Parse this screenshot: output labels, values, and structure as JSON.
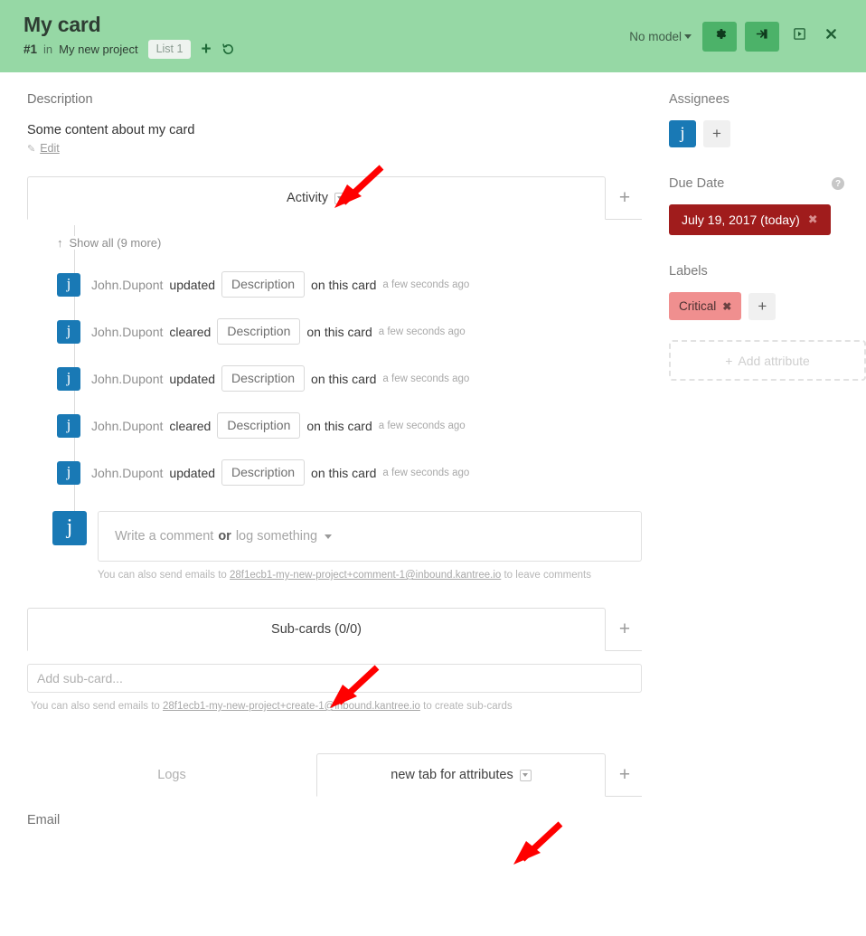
{
  "header": {
    "title": "My card",
    "card_number": "#1",
    "in_word": "in",
    "project": "My new project",
    "list_chip": "List 1",
    "add_icon": "plus-icon",
    "history_icon": "history-icon",
    "model_label": "No model",
    "gear_icon": "gear-icon",
    "login_icon": "sign-in-icon",
    "play_icon": "play-box-icon",
    "close_icon": "close-icon",
    "bg_color": "#96d8a5",
    "button_color": "#4cb269"
  },
  "description": {
    "label": "Description",
    "content": "Some content about my card",
    "edit_label": "Edit",
    "edit_icon": "pencil-icon"
  },
  "activity_tabs": {
    "active": "Activity",
    "caret_icon": "caret-down-box-icon",
    "add_icon": "plus-icon"
  },
  "activity": {
    "show_all": "Show all (9 more)",
    "show_all_icon": "arrow-up-icon",
    "entries": [
      {
        "avatar": "j",
        "user": "John.Dupont",
        "verb": "updated",
        "attribute": "Description",
        "object": "on this card",
        "time": "a few seconds ago"
      },
      {
        "avatar": "j",
        "user": "John.Dupont",
        "verb": "cleared",
        "attribute": "Description",
        "object": "on this card",
        "time": "a few seconds ago"
      },
      {
        "avatar": "j",
        "user": "John.Dupont",
        "verb": "updated",
        "attribute": "Description",
        "object": "on this card",
        "time": "a few seconds ago"
      },
      {
        "avatar": "j",
        "user": "John.Dupont",
        "verb": "cleared",
        "attribute": "Description",
        "object": "on this card",
        "time": "a few seconds ago"
      },
      {
        "avatar": "j",
        "user": "John.Dupont",
        "verb": "updated",
        "attribute": "Description",
        "object": "on this card",
        "time": "a few seconds ago"
      }
    ],
    "comment": {
      "avatar": "j",
      "placeholder_1": "Write a comment",
      "placeholder_or": "or",
      "placeholder_2": "log something",
      "caret_icon": "caret-down-icon"
    },
    "email_hint_prefix": "You can also send emails to",
    "email_address": "28f1ecb1-my-new-project+comment-1@inbound.kantree.io",
    "email_hint_suffix": "to leave comments"
  },
  "subcards": {
    "tab_label": "Sub-cards (0/0)",
    "add_icon": "plus-icon",
    "input_placeholder": "Add sub-card...",
    "email_hint_prefix": "You can also send emails to",
    "email_address": "28f1ecb1-my-new-project+create-1@inbound.kantree.io",
    "email_hint_suffix": "to create sub-cards"
  },
  "bottom_tabs": {
    "logs_label": "Logs",
    "attributes_label": "new tab for attributes",
    "caret_icon": "caret-down-box-icon",
    "add_icon": "plus-icon",
    "footer_label": "Email"
  },
  "sidebar": {
    "assignees": {
      "label": "Assignees",
      "avatar": "j",
      "add_icon": "plus-icon"
    },
    "due_date": {
      "label": "Due Date",
      "help_icon": "help-icon",
      "value": "July 19, 2017 (today)",
      "remove_icon": "close-icon",
      "color": "#a01c1c"
    },
    "labels": {
      "label": "Labels",
      "chips": [
        {
          "text": "Critical",
          "color": "#f08f8f",
          "remove_icon": "close-icon"
        }
      ],
      "add_icon": "plus-icon"
    },
    "add_attribute": {
      "label": "Add attribute",
      "icon": "plus-icon"
    }
  },
  "annotations": {
    "arrow_color": "#ff0000",
    "arrows": [
      {
        "name": "arrow-to-activity-tab"
      },
      {
        "name": "arrow-to-subcards-tab"
      },
      {
        "name": "arrow-to-attributes-tab"
      }
    ]
  }
}
